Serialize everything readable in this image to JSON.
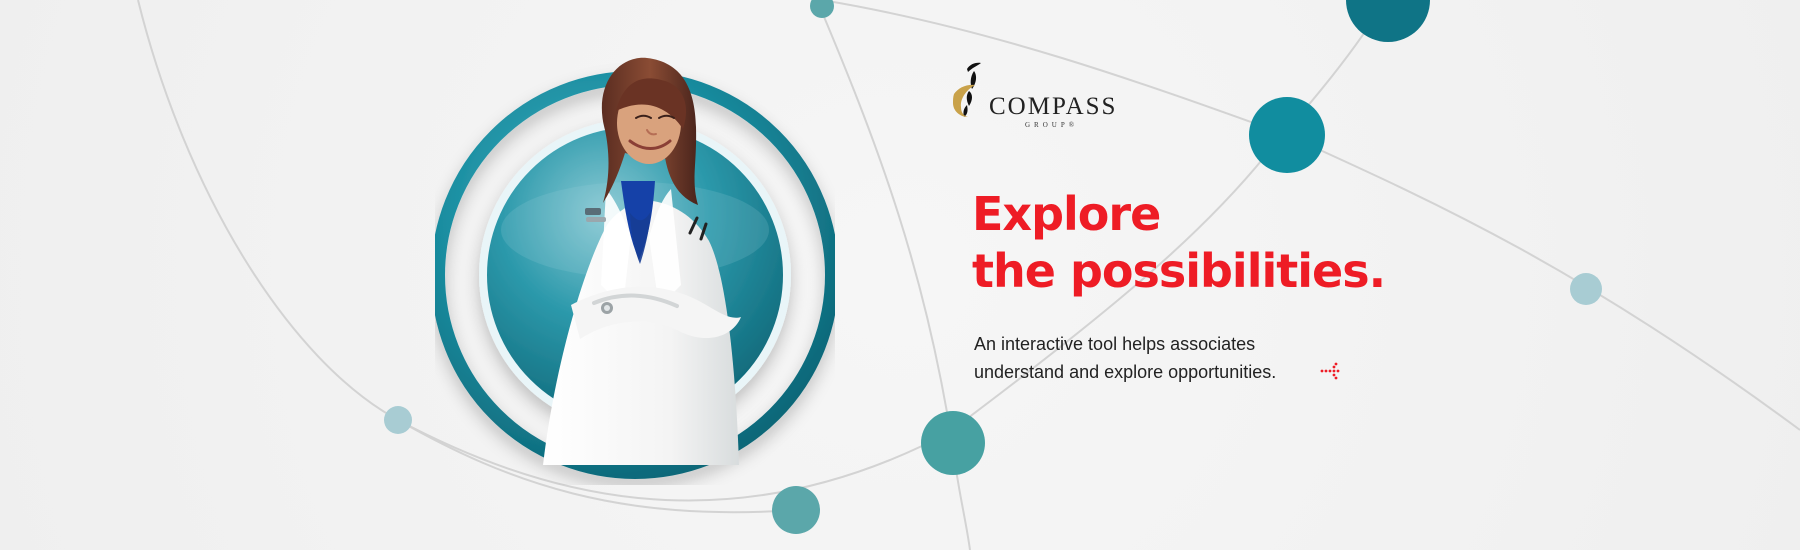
{
  "hero": {
    "headline": {
      "line1": "Explore",
      "line2": "the possibilities."
    },
    "description": {
      "line1": "An interactive tool helps associates",
      "line2": "understand and explore opportunities."
    },
    "link_icon": "dotted-arrow-icon"
  },
  "brand": {
    "name": "COMPASS",
    "subtitle": "GROUP®",
    "logo_icon": "compass-group-logo-icon"
  },
  "portrait": {
    "subject": "doctor-portrait"
  },
  "colors": {
    "headline_red": "#ee1c25",
    "text_dark": "#222222",
    "teal_dark": "#0f7486",
    "teal_mid": "#168b9c",
    "teal_light": "#a8ccd3",
    "background": "#f3f3f3",
    "logo_gold": "#c9a24a"
  }
}
